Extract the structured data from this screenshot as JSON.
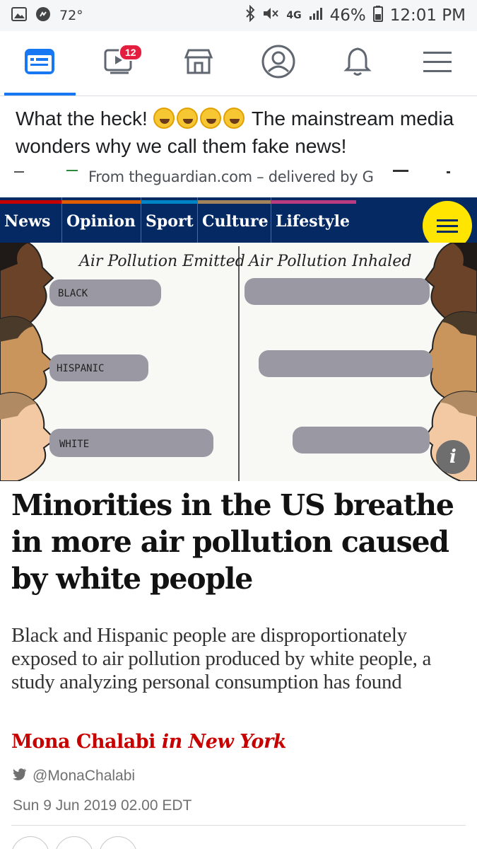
{
  "status_bar": {
    "temperature": "72°",
    "network": "4G",
    "battery": "46%",
    "time": "12:01 PM"
  },
  "fb_nav": {
    "tabs": [
      "news-feed",
      "watch",
      "marketplace",
      "profile",
      "notifications",
      "menu"
    ],
    "watch_badge": "12",
    "accent_color": "#1877f2"
  },
  "post": {
    "text_before": "What the heck! ",
    "text_after": " The mainstream media wonders why we call them fake news!",
    "emoji_count": 4,
    "delivered_by": "From theguardian.com – delivered by G"
  },
  "guardian_nav": {
    "items": [
      {
        "label": "News",
        "color": "#c70000"
      },
      {
        "label": "Opinion",
        "color": "#e05e00"
      },
      {
        "label": "Sport",
        "color": "#0084c6"
      },
      {
        "label": "Culture",
        "color": "#a1845c"
      },
      {
        "label": "Lifestyle",
        "color": "#bb3b80"
      }
    ],
    "background": "#052962"
  },
  "illustration": {
    "left_title": "Air Pollution Emitted",
    "right_title": "Air Pollution Inhaled",
    "labels": [
      "BLACK",
      "HISPANIC",
      "WHITE"
    ]
  },
  "article": {
    "headline": "Minorities in the US breathe in more air pollution caused by white people",
    "standfirst": "Black and Hispanic people are disproportionately exposed to air pollution produced by white people, a study analyzing personal consumption has found",
    "author": "Mona Chalabi",
    "location": "in New York",
    "twitter_handle": "@MonaChalabi",
    "date": "Sun 9 Jun 2019 02.00 EDT"
  }
}
